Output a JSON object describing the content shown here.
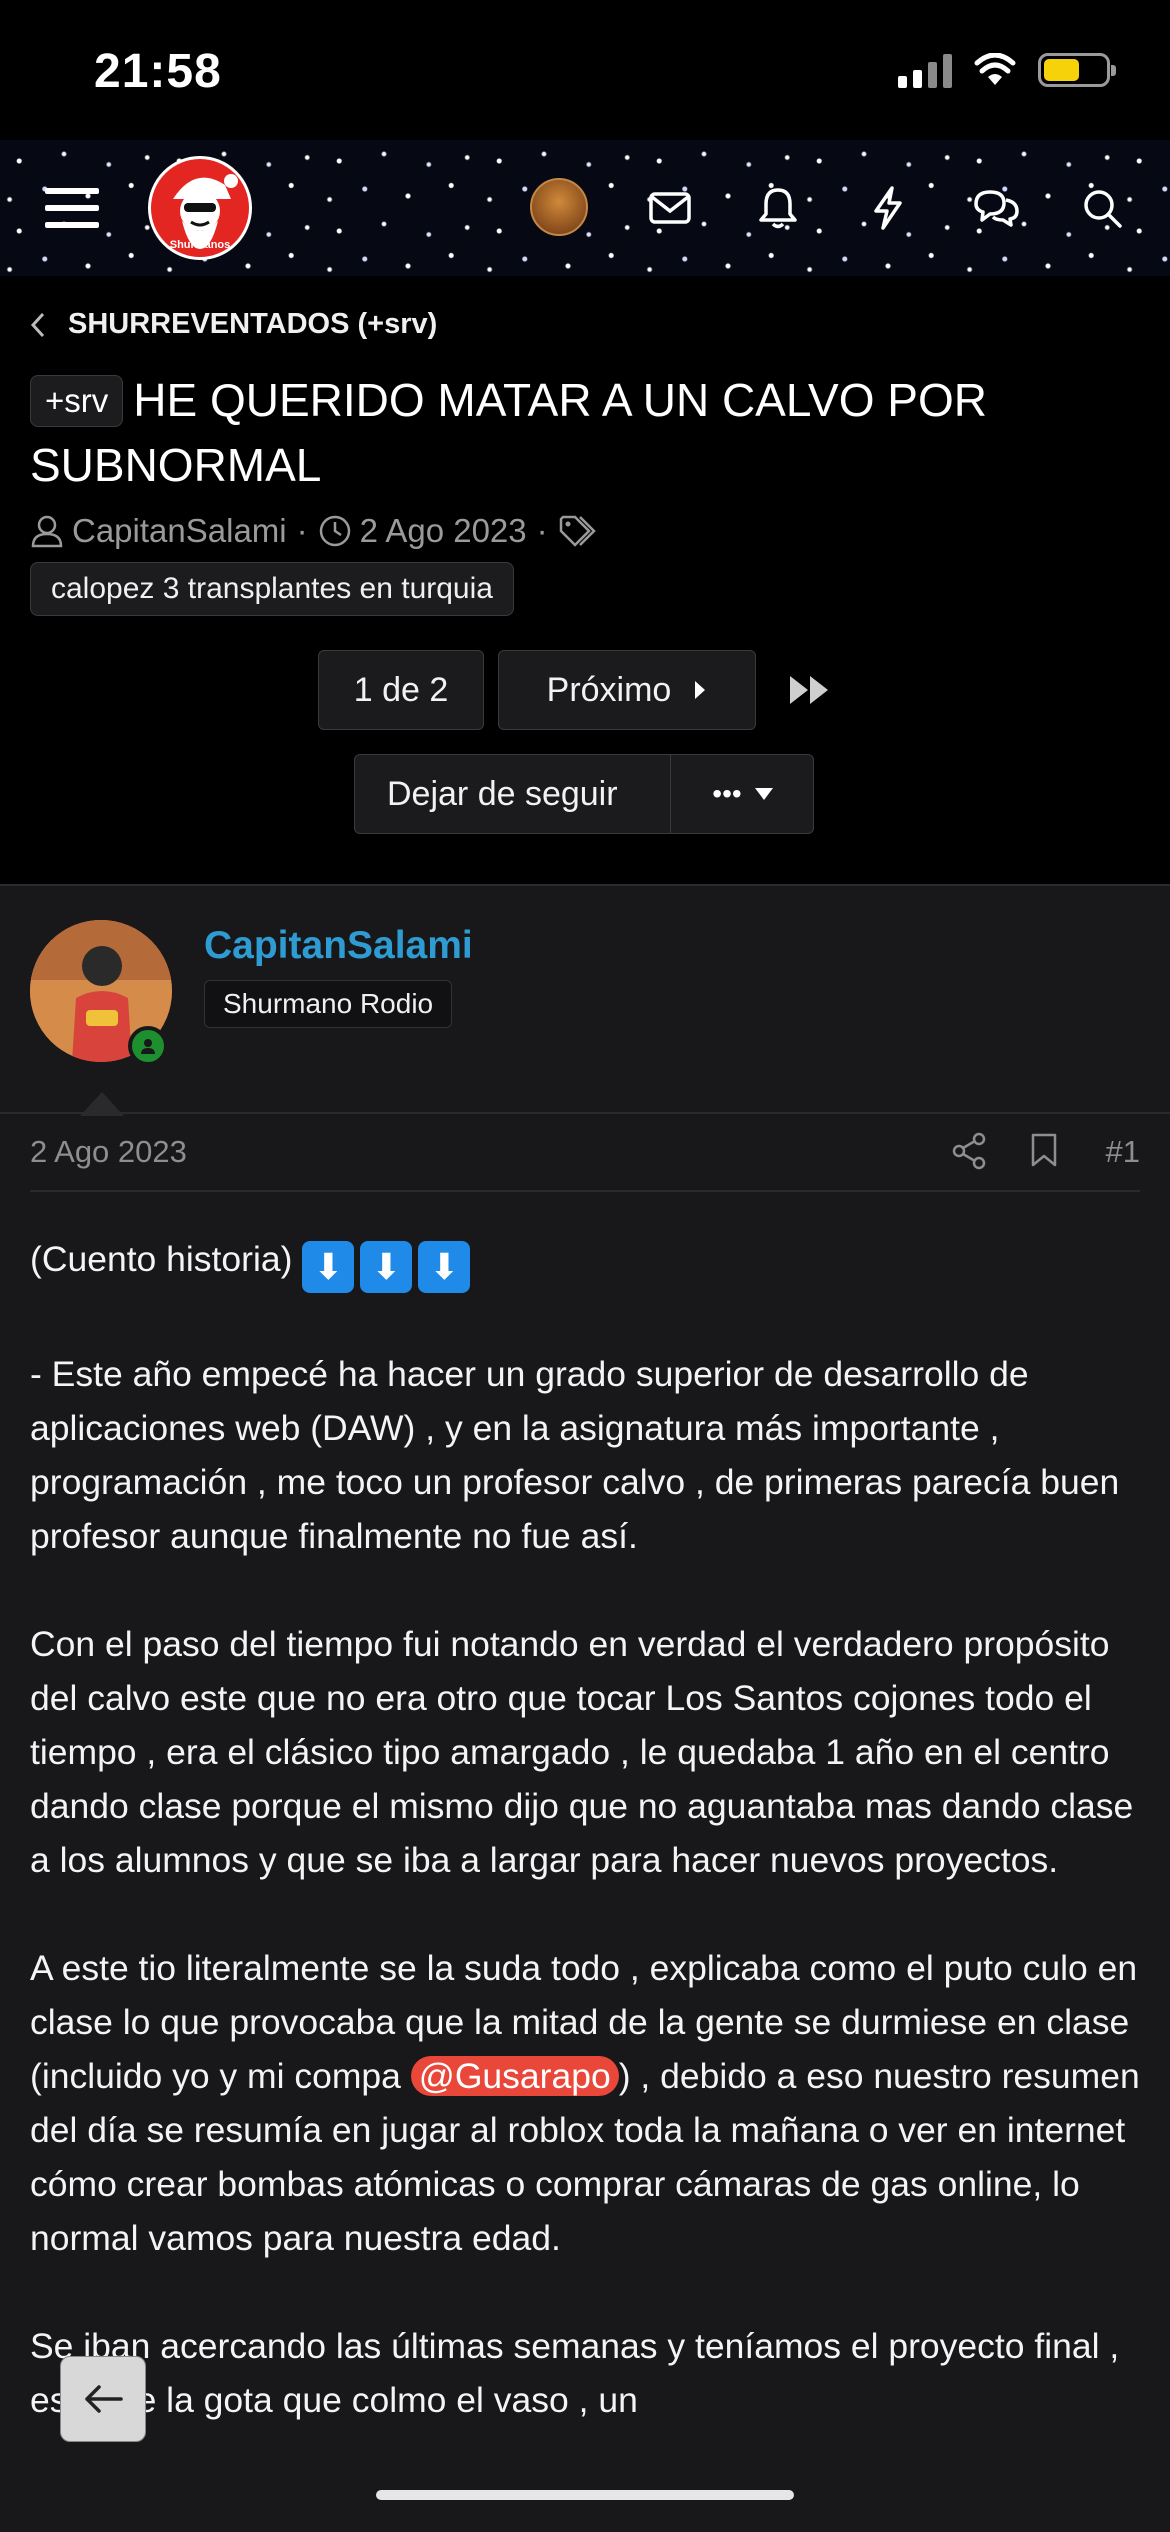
{
  "status": {
    "time": "21:58"
  },
  "nav": {
    "menu_icon": "hamburger-icon",
    "logo_text": "Shurmanos",
    "icons": [
      "avatar",
      "mail-icon",
      "bell-icon",
      "bolt-icon",
      "chat-icon",
      "search-icon"
    ]
  },
  "thread": {
    "breadcrumb": "SHURREVENTADOS (+srv)",
    "prefix": "+srv",
    "title": "HE QUERIDO MATAR A UN CALVO POR SUBNORMAL",
    "author": "CapitanSalami",
    "date": "2 Ago 2023",
    "tag": "calopez 3 transplantes en turquia",
    "page_label": "1 de 2",
    "next_label": "Próximo",
    "unfollow_label": "Dejar de seguir",
    "more_label": "•••"
  },
  "post": {
    "username": "CapitanSalami",
    "rank": "Shurmano Rodio",
    "date": "2 Ago 2023",
    "number": "#1",
    "intro": "(Cuento historia)",
    "emoji_count": 3,
    "p1": "- Este año empecé ha hacer un grado superior de desarrollo de aplicaciones web (DAW) , y en la asignatura más importante , programación , me toco un profesor calvo , de primeras parecía buen profesor aunque finalmente no fue así.",
    "p2": "Con el paso del tiempo fui notando en verdad el verdadero propósito del calvo este que no era otro que tocar Los Santos cojones todo el tiempo , era el clásico tipo amargado , le quedaba 1 año en el centro dando clase porque el mismo dijo que no aguantaba mas dando clase a los alumnos y que se iba a largar para hacer nuevos proyectos.",
    "p3_before": "A este tio literalmente se la suda todo , explicaba como el puto culo en clase lo que provocaba que la mitad de la gente se durmiese en clase (incluido yo y mi compa ",
    "p3_mention": "@Gusarapo",
    "p3_after": ") , debido a eso nuestro resumen del día se resumía en jugar al roblox toda la mañana o ver en internet cómo crear bombas atómicas o comprar cámaras de gas online, lo normal vamos para nuestra edad.",
    "p4": "Se iban acercando las últimas semanas y teníamos el proyecto final , esto fue la gota que colmo el vaso , un"
  }
}
